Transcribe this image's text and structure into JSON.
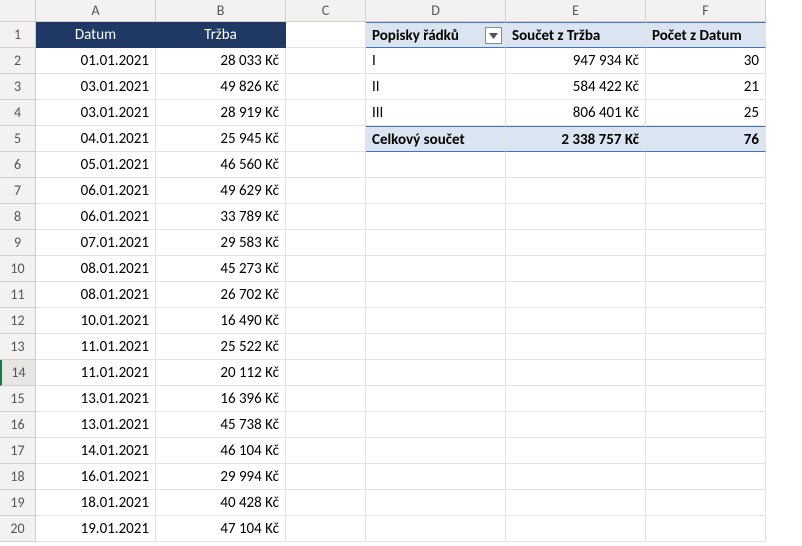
{
  "columns": [
    "A",
    "B",
    "C",
    "D",
    "E",
    "F"
  ],
  "tableHeader": {
    "A": "Datum",
    "B": "Tržba"
  },
  "rows": [
    {
      "date": "01.01.2021",
      "amount": "28 033 Kč"
    },
    {
      "date": "03.01.2021",
      "amount": "49 826 Kč"
    },
    {
      "date": "03.01.2021",
      "amount": "28 919 Kč"
    },
    {
      "date": "04.01.2021",
      "amount": "25 945 Kč"
    },
    {
      "date": "05.01.2021",
      "amount": "46 560 Kč"
    },
    {
      "date": "06.01.2021",
      "amount": "49 629 Kč"
    },
    {
      "date": "06.01.2021",
      "amount": "33 789 Kč"
    },
    {
      "date": "07.01.2021",
      "amount": "29 583 Kč"
    },
    {
      "date": "08.01.2021",
      "amount": "45 273 Kč"
    },
    {
      "date": "08.01.2021",
      "amount": "26 702 Kč"
    },
    {
      "date": "10.01.2021",
      "amount": "16 490 Kč"
    },
    {
      "date": "11.01.2021",
      "amount": "25 522 Kč"
    },
    {
      "date": "11.01.2021",
      "amount": "20 112 Kč"
    },
    {
      "date": "13.01.2021",
      "amount": "16 396 Kč"
    },
    {
      "date": "13.01.2021",
      "amount": "45 738 Kč"
    },
    {
      "date": "14.01.2021",
      "amount": "46 104 Kč"
    },
    {
      "date": "16.01.2021",
      "amount": "29 994 Kč"
    },
    {
      "date": "18.01.2021",
      "amount": "40 428 Kč"
    },
    {
      "date": "19.01.2021",
      "amount": "47 104 Kč"
    }
  ],
  "pivot": {
    "headers": {
      "D": "Popisky řádků",
      "E": "Součet z Tržba",
      "F": "Počet z Datum"
    },
    "rows": [
      {
        "label": "I",
        "sum": "947 934 Kč",
        "count": "30"
      },
      {
        "label": "II",
        "sum": "584 422 Kč",
        "count": "21"
      },
      {
        "label": "III",
        "sum": "806 401 Kč",
        "count": "25"
      }
    ],
    "total": {
      "label": "Celkový součet",
      "sum": "2 338 757 Kč",
      "count": "76"
    }
  },
  "activeRow": 14
}
